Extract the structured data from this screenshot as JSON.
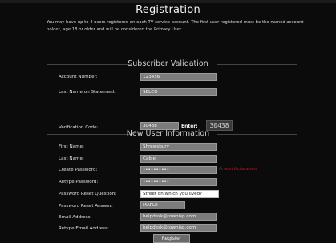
{
  "page": {
    "title": "Registration",
    "intro": "You may have up to 4 users registered on each TV service account. The first user registered must be the named account holder, age 18 or older and will be considered the Primary User."
  },
  "subscriber_validation": {
    "heading": "Subscriber Validation",
    "account_number": {
      "label": "Account Number:",
      "value": "123456"
    },
    "last_name": {
      "label": "Last Name on Statement:",
      "value": "SELCO"
    },
    "verification_code": {
      "label": "Verification Code:",
      "value": "30438"
    },
    "enter_label": "Enter:",
    "captcha_text": "30438"
  },
  "new_user": {
    "heading": "New User Information",
    "first_name": {
      "label": "First Name:",
      "value": "Shrewsbury"
    },
    "last_name": {
      "label": "Last Name:",
      "value": "Cable"
    },
    "create_password": {
      "label": "Create Password:",
      "value": "••••••••••",
      "hint": "At least 6 characters"
    },
    "retype_password": {
      "label": "Retype Password:",
      "value": "••••••••••"
    },
    "reset_question": {
      "label": "Password Reset Question:",
      "value": "Street on which you lived?"
    },
    "reset_answer": {
      "label": "Password Reset Answer:",
      "value": "MAPLE"
    },
    "email": {
      "label": "Email Address:",
      "value": "helpdesk@townisp.com"
    },
    "retype_email": {
      "label": "Retype Email Address:",
      "value": "helpdesk@townisp.com"
    }
  },
  "register_button": "Register"
}
